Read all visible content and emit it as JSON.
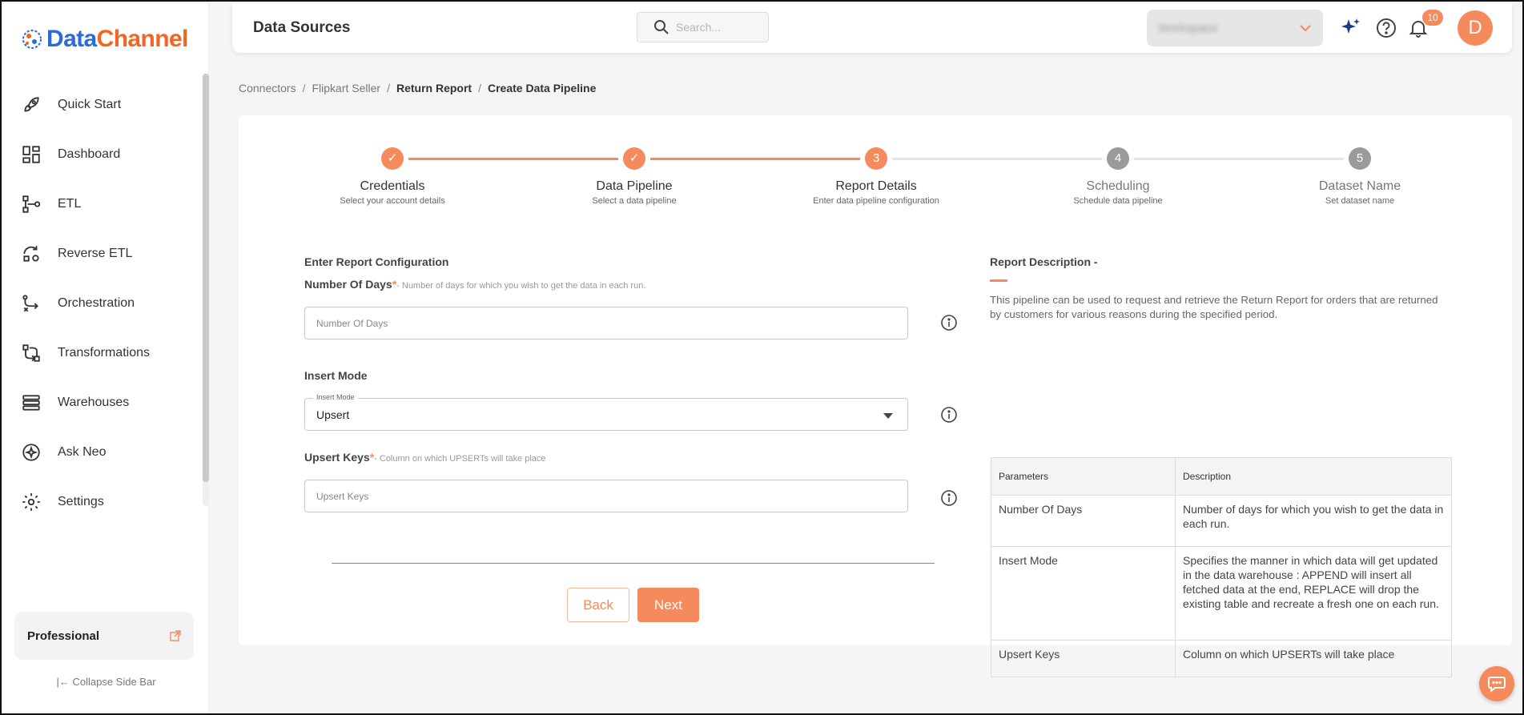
{
  "brand": {
    "part1": "Data",
    "part2": "Channel"
  },
  "sidebar": {
    "items": [
      {
        "label": "Quick Start",
        "icon": "rocket-icon"
      },
      {
        "label": "Dashboard",
        "icon": "dashboard-icon"
      },
      {
        "label": "ETL",
        "icon": "etl-icon"
      },
      {
        "label": "Reverse ETL",
        "icon": "reverse-etl-icon"
      },
      {
        "label": "Orchestration",
        "icon": "orchestration-icon"
      },
      {
        "label": "Transformations",
        "icon": "transformations-icon"
      },
      {
        "label": "Warehouses",
        "icon": "warehouses-icon"
      },
      {
        "label": "Ask Neo",
        "icon": "sparkle-icon"
      },
      {
        "label": "Settings",
        "icon": "gear-icon"
      }
    ],
    "plan": "Professional",
    "collapse_label": "Collapse Side Bar"
  },
  "header": {
    "title": "Data Sources",
    "search_placeholder": "Search...",
    "workspace_name": "Workspace",
    "notification_count": "10",
    "avatar_initial": "D"
  },
  "breadcrumb": {
    "items": [
      "Connectors",
      "Flipkart Seller",
      "Return Report",
      "Create Data Pipeline"
    ]
  },
  "stepper": {
    "steps": [
      {
        "num": "1",
        "title": "Credentials",
        "subtitle": "Select your account details",
        "state": "done"
      },
      {
        "num": "2",
        "title": "Data Pipeline",
        "subtitle": "Select a data pipeline",
        "state": "done"
      },
      {
        "num": "3",
        "title": "Report Details",
        "subtitle": "Enter data pipeline configuration",
        "state": "active"
      },
      {
        "num": "4",
        "title": "Scheduling",
        "subtitle": "Schedule data pipeline",
        "state": "pending"
      },
      {
        "num": "5",
        "title": "Dataset Name",
        "subtitle": "Set dataset name",
        "state": "pending"
      }
    ]
  },
  "form": {
    "section_title": "Enter Report Configuration",
    "days": {
      "label": "Number Of Days",
      "required": "*",
      "hint": "- Number of days for which you wish to get the data in each run.",
      "placeholder": "Number Of Days",
      "value": ""
    },
    "insert_mode": {
      "label": "Insert Mode",
      "float_label": "Insert Mode",
      "value": "Upsert"
    },
    "upsert_keys": {
      "label": "Upsert Keys",
      "required": "*",
      "hint": "- Column on which UPSERTs will take place",
      "placeholder": "Upsert Keys",
      "value": ""
    },
    "back_label": "Back",
    "next_label": "Next"
  },
  "description": {
    "title": "Report Description -",
    "text": "This pipeline can be used to request and retrieve the Return Report for orders that are returned by customers for various reasons during the specified period.",
    "columns": [
      "Parameters",
      "Description"
    ],
    "rows": [
      [
        "Number Of Days",
        "Number of days for which you wish to get the data in each run."
      ],
      [
        "Insert Mode",
        "Specifies the manner in which data will get updated in the data warehouse : APPEND will insert all fetched data at the end, REPLACE will drop the existing table and recreate a fresh one on each run."
      ],
      [
        "Upsert Keys",
        "Column on which UPSERTs will take place"
      ]
    ]
  },
  "colors": {
    "accent": "#f58a5c",
    "brand_blue": "#2a6bd8",
    "brand_orange": "#f26522",
    "pending": "#9a9a9a"
  }
}
